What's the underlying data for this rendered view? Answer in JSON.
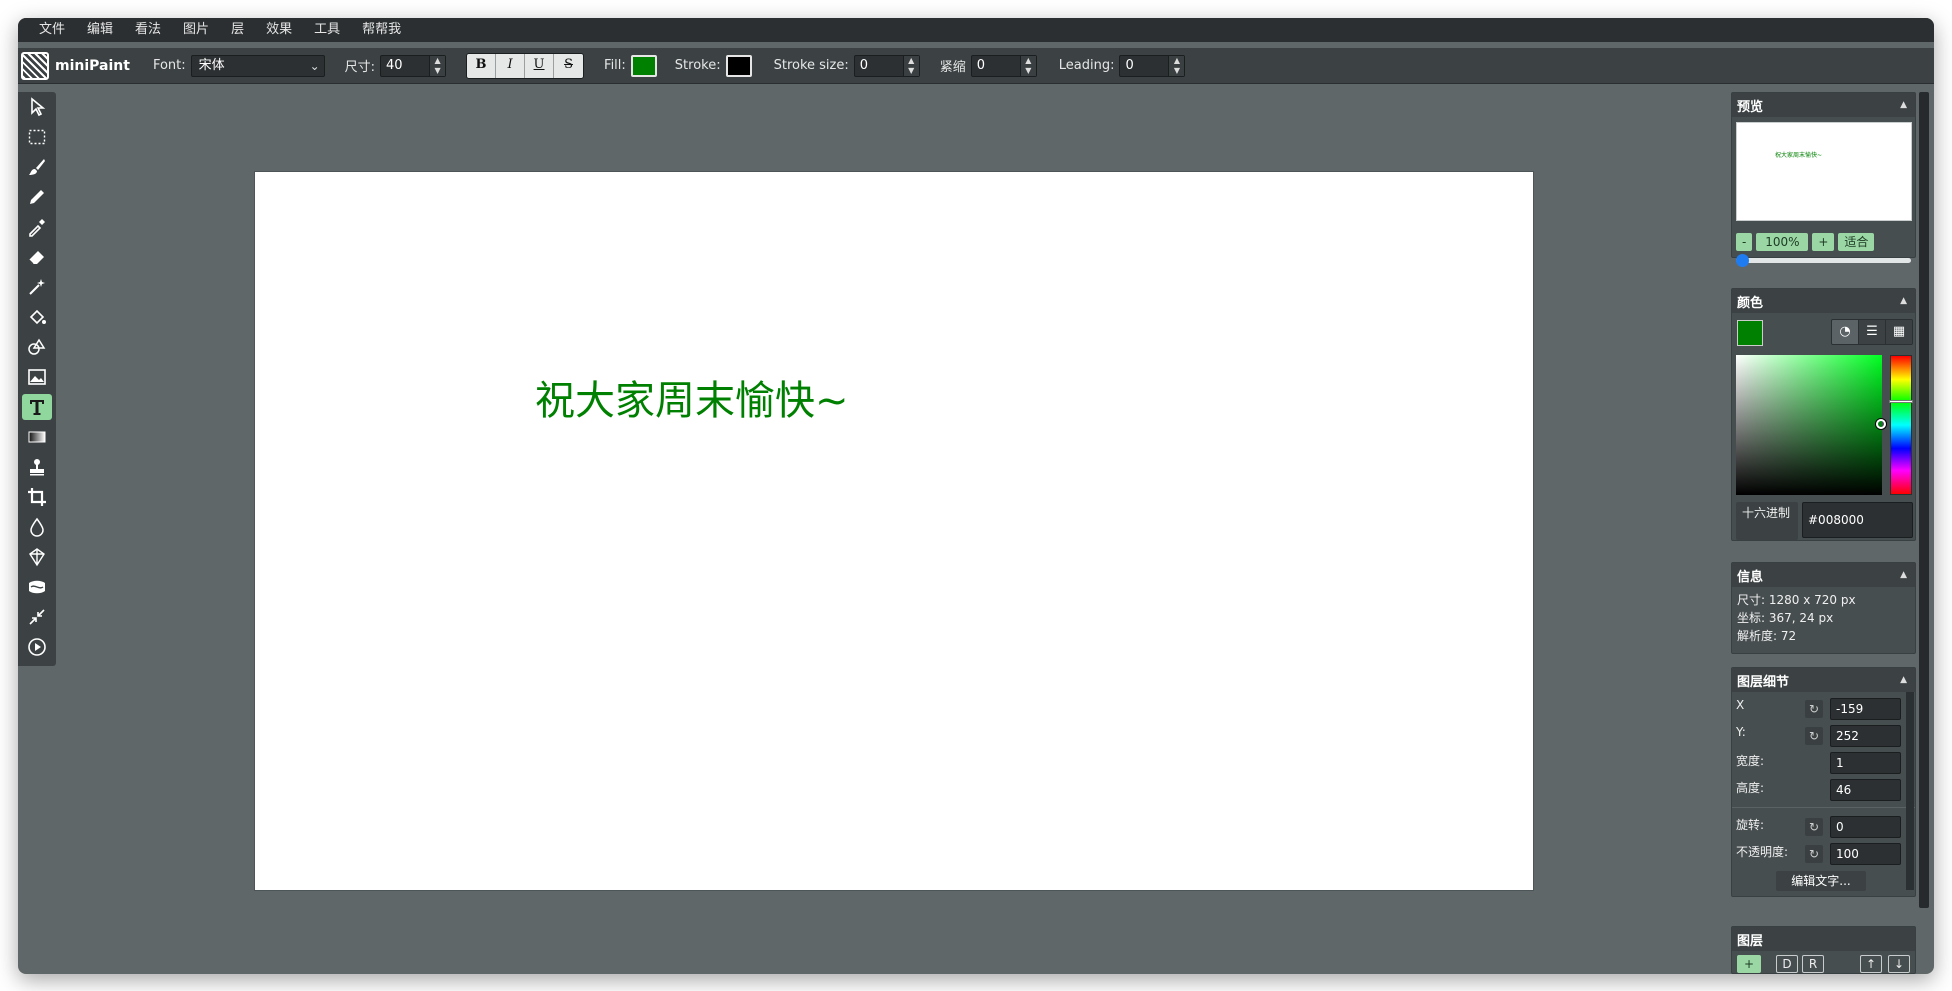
{
  "menu": [
    "文件",
    "编辑",
    "看法",
    "图片",
    "层",
    "效果",
    "工具",
    "帮帮我"
  ],
  "app": {
    "name": "miniPaint"
  },
  "attributes": {
    "font_label": "Font:",
    "font_value": "宋体",
    "size_label": "尺寸:",
    "size_value": "40",
    "format_buttons": [
      "B",
      "I",
      "U",
      "S"
    ],
    "fill_label": "Fill:",
    "fill_color": "#008000",
    "stroke_label": "Stroke:",
    "stroke_color": "#000000",
    "stroke_size_label": "Stroke size:",
    "stroke_size_value": "0",
    "kerning_label": "紧缩",
    "kerning_value": "0",
    "leading_label": "Leading:",
    "leading_value": "0"
  },
  "tools": [
    "select-arrow-icon",
    "rectangle-select-icon",
    "brush-icon",
    "pencil-icon",
    "color-picker-icon",
    "eraser-icon",
    "magic-wand-icon",
    "fill-bucket-icon",
    "shapes-icon",
    "image-icon",
    "text-icon",
    "gradient-icon",
    "clone-stamp-icon",
    "crop-icon",
    "blur-drop-icon",
    "sharpen-icon",
    "bulge-icon",
    "resize-icon",
    "animation-play-icon"
  ],
  "canvas": {
    "text": "祝大家周末愉快~",
    "text_color": "#008000"
  },
  "preview": {
    "title": "预览",
    "thumb_text": "祝大家周末愉快~",
    "zoom_minus": "-",
    "zoom_value": "100%",
    "zoom_plus": "+",
    "zoom_fit": "适合"
  },
  "color_panel": {
    "title": "颜色",
    "current": "#008000",
    "hex_label": "十六进制",
    "hex_value": "#008000"
  },
  "info": {
    "title": "信息",
    "size": "尺寸: 1280 x 720 px",
    "coords": "坐标: 367, 24 px",
    "resolution": "解析度: 72"
  },
  "layer_details": {
    "title": "图层细节",
    "x_label": "X",
    "x_value": "-159",
    "y_label": "Y:",
    "y_value": "252",
    "w_label": "宽度:",
    "w_value": "1",
    "h_label": "高度:",
    "h_value": "46",
    "rot_label": "旋转:",
    "rot_value": "0",
    "opacity_label": "不透明度:",
    "opacity_value": "100",
    "edit_text": "编辑文字..."
  },
  "layers": {
    "title": "图层",
    "add": "+",
    "d": "D",
    "r": "R",
    "up": "↑",
    "down": "↓"
  }
}
